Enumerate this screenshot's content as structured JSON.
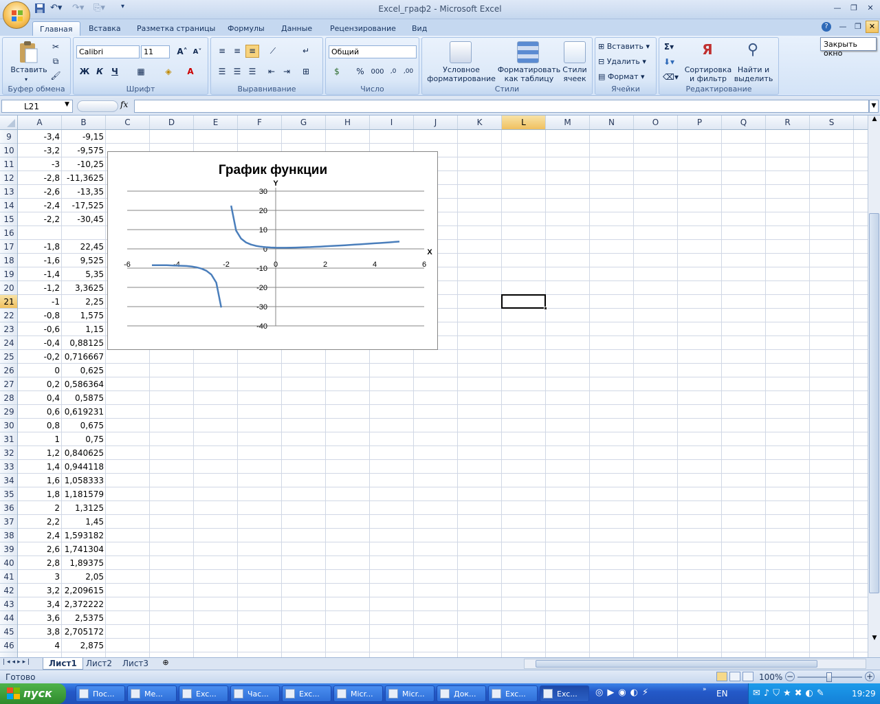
{
  "window": {
    "title": "Excel_граф2 - Microsoft Excel"
  },
  "ribbon_tabs": [
    "Главная",
    "Вставка",
    "Разметка страницы",
    "Формулы",
    "Данные",
    "Рецензирование",
    "Вид"
  ],
  "tooltip": "Закрыть окно",
  "groups": {
    "clipboard": {
      "label": "Буфер обмена",
      "paste": "Вставить"
    },
    "font": {
      "label": "Шрифт",
      "font_name": "Calibri",
      "font_size": "11",
      "bold": "Ж",
      "italic": "К",
      "underline": "Ч"
    },
    "alignment": {
      "label": "Выравнивание"
    },
    "number": {
      "label": "Число",
      "format": "Общий",
      "percent": "%",
      "thousands": "000"
    },
    "styles": {
      "label": "Стили",
      "conditional": "Условное форматирование",
      "as_table": "Форматировать как таблицу",
      "cell_styles": "Стили ячеек"
    },
    "cells": {
      "label": "Ячейки",
      "insert": "Вставить",
      "delete": "Удалить",
      "format": "Формат"
    },
    "editing": {
      "label": "Редактирование",
      "sort": "Сортировка и фильтр",
      "find": "Найти и выделить"
    }
  },
  "formula_bar": {
    "name_box": "L21",
    "fx": "fx",
    "formula": ""
  },
  "columns": [
    "A",
    "B",
    "C",
    "D",
    "E",
    "F",
    "G",
    "H",
    "I",
    "J",
    "K",
    "L",
    "M",
    "N",
    "O",
    "P",
    "Q",
    "R",
    "S"
  ],
  "selected_column": "L",
  "selected_row": "21",
  "rows": [
    {
      "n": "9",
      "a": "-3,4",
      "b": "-9,15"
    },
    {
      "n": "10",
      "a": "-3,2",
      "b": "-9,575"
    },
    {
      "n": "11",
      "a": "-3",
      "b": "-10,25"
    },
    {
      "n": "12",
      "a": "-2,8",
      "b": "-11,3625"
    },
    {
      "n": "13",
      "a": "-2,6",
      "b": "-13,35"
    },
    {
      "n": "14",
      "a": "-2,4",
      "b": "-17,525"
    },
    {
      "n": "15",
      "a": "-2,2",
      "b": "-30,45"
    },
    {
      "n": "16",
      "a": "",
      "b": ""
    },
    {
      "n": "17",
      "a": "-1,8",
      "b": "22,45"
    },
    {
      "n": "18",
      "a": "-1,6",
      "b": "9,525"
    },
    {
      "n": "19",
      "a": "-1,4",
      "b": "5,35"
    },
    {
      "n": "20",
      "a": "-1,2",
      "b": "3,3625"
    },
    {
      "n": "21",
      "a": "-1",
      "b": "2,25"
    },
    {
      "n": "22",
      "a": "-0,8",
      "b": "1,575"
    },
    {
      "n": "23",
      "a": "-0,6",
      "b": "1,15"
    },
    {
      "n": "24",
      "a": "-0,4",
      "b": "0,88125"
    },
    {
      "n": "25",
      "a": "-0,2",
      "b": "0,716667"
    },
    {
      "n": "26",
      "a": "0",
      "b": "0,625"
    },
    {
      "n": "27",
      "a": "0,2",
      "b": "0,586364"
    },
    {
      "n": "28",
      "a": "0,4",
      "b": "0,5875"
    },
    {
      "n": "29",
      "a": "0,6",
      "b": "0,619231"
    },
    {
      "n": "30",
      "a": "0,8",
      "b": "0,675"
    },
    {
      "n": "31",
      "a": "1",
      "b": "0,75"
    },
    {
      "n": "32",
      "a": "1,2",
      "b": "0,840625"
    },
    {
      "n": "33",
      "a": "1,4",
      "b": "0,944118"
    },
    {
      "n": "34",
      "a": "1,6",
      "b": "1,058333"
    },
    {
      "n": "35",
      "a": "1,8",
      "b": "1,181579"
    },
    {
      "n": "36",
      "a": "2",
      "b": "1,3125"
    },
    {
      "n": "37",
      "a": "2,2",
      "b": "1,45"
    },
    {
      "n": "38",
      "a": "2,4",
      "b": "1,593182"
    },
    {
      "n": "39",
      "a": "2,6",
      "b": "1,741304"
    },
    {
      "n": "40",
      "a": "2,8",
      "b": "1,89375"
    },
    {
      "n": "41",
      "a": "3",
      "b": "2,05"
    },
    {
      "n": "42",
      "a": "3,2",
      "b": "2,209615"
    },
    {
      "n": "43",
      "a": "3,4",
      "b": "2,372222"
    },
    {
      "n": "44",
      "a": "3,6",
      "b": "2,5375"
    },
    {
      "n": "45",
      "a": "3,8",
      "b": "2,705172"
    },
    {
      "n": "46",
      "a": "4",
      "b": "2,875"
    }
  ],
  "chart_data": {
    "type": "scatter",
    "title": "График функции",
    "xlabel": "X",
    "ylabel": "Y",
    "xlim": [
      -6,
      6
    ],
    "ylim": [
      -40,
      30
    ],
    "x_ticks": [
      "-6",
      "-4",
      "-2",
      "0",
      "2",
      "4",
      "6"
    ],
    "y_ticks": [
      "30",
      "20",
      "10",
      "0",
      "-10",
      "-20",
      "-30",
      "-40"
    ],
    "series": [
      {
        "values_left": {
          "x": [
            -5,
            -4.8,
            -4.6,
            -4.4,
            -4.2,
            -4,
            -3.8,
            -3.6,
            -3.4,
            -3.2,
            -3,
            -2.8,
            -2.6,
            -2.4,
            -2.2
          ],
          "y": [
            -8.5,
            -8.5,
            -8.5,
            -8.5,
            -8.6,
            -8.7,
            -8.8,
            -8.9,
            -9.15,
            -9.575,
            -10.25,
            -11.3625,
            -13.35,
            -17.525,
            -30.45
          ]
        },
        "values_right": {
          "x": [
            -1.8,
            -1.6,
            -1.4,
            -1.2,
            -1,
            -0.8,
            -0.6,
            -0.4,
            -0.2,
            0,
            0.2,
            0.4,
            0.6,
            0.8,
            1,
            1.2,
            1.4,
            1.6,
            1.8,
            2,
            2.2,
            2.4,
            2.6,
            2.8,
            3,
            3.2,
            3.4,
            3.6,
            3.8,
            4,
            4.2,
            4.4,
            4.6,
            4.8,
            5
          ],
          "y": [
            22.45,
            9.525,
            5.35,
            3.3625,
            2.25,
            1.575,
            1.15,
            0.88125,
            0.716667,
            0.625,
            0.586364,
            0.5875,
            0.619231,
            0.675,
            0.75,
            0.840625,
            0.944118,
            1.058333,
            1.181579,
            1.3125,
            1.45,
            1.593182,
            1.741304,
            1.89375,
            2.05,
            2.209615,
            2.372222,
            2.5375,
            2.705172,
            2.875,
            3.05,
            3.23,
            3.41,
            3.6,
            3.8
          ]
        },
        "color": "#4a7ebb"
      }
    ]
  },
  "sheets": [
    "Лист1",
    "Лист2",
    "Лист3"
  ],
  "status": {
    "ready": "Готово",
    "zoom": "100%"
  },
  "taskbar": {
    "start": "пуск",
    "items": [
      "Пос...",
      "Ме...",
      "Exc...",
      "Час...",
      "Exc...",
      "Micr...",
      "Micr...",
      "Док...",
      "Exc...",
      "Exc..."
    ],
    "lang": "EN",
    "clock": "19:29"
  }
}
